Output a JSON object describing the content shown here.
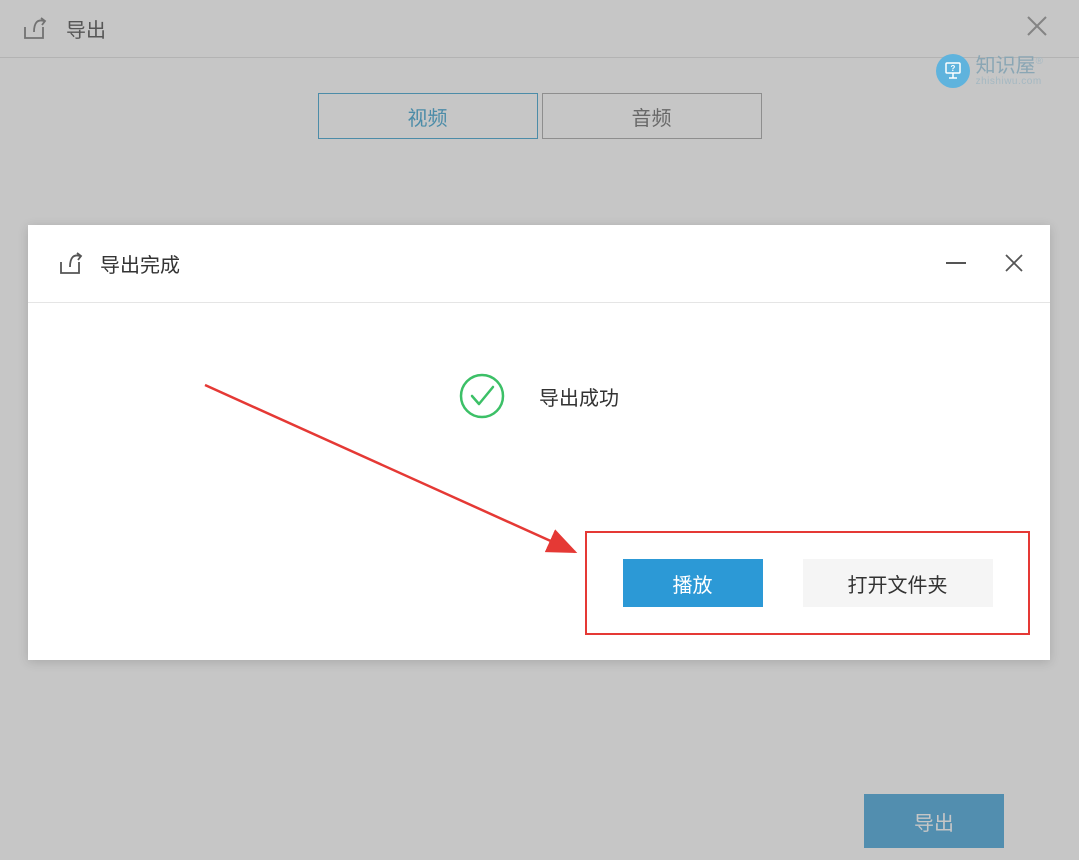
{
  "backWindow": {
    "title": "导出",
    "tabs": {
      "video": "视频",
      "audio": "音频"
    },
    "exportButton": "导出"
  },
  "modal": {
    "title": "导出完成",
    "successText": "导出成功",
    "playButton": "播放",
    "openFolderButton": "打开文件夹"
  },
  "watermark": {
    "main": "知识屋",
    "sub": "zhishiwu.com",
    "reg": "®"
  }
}
